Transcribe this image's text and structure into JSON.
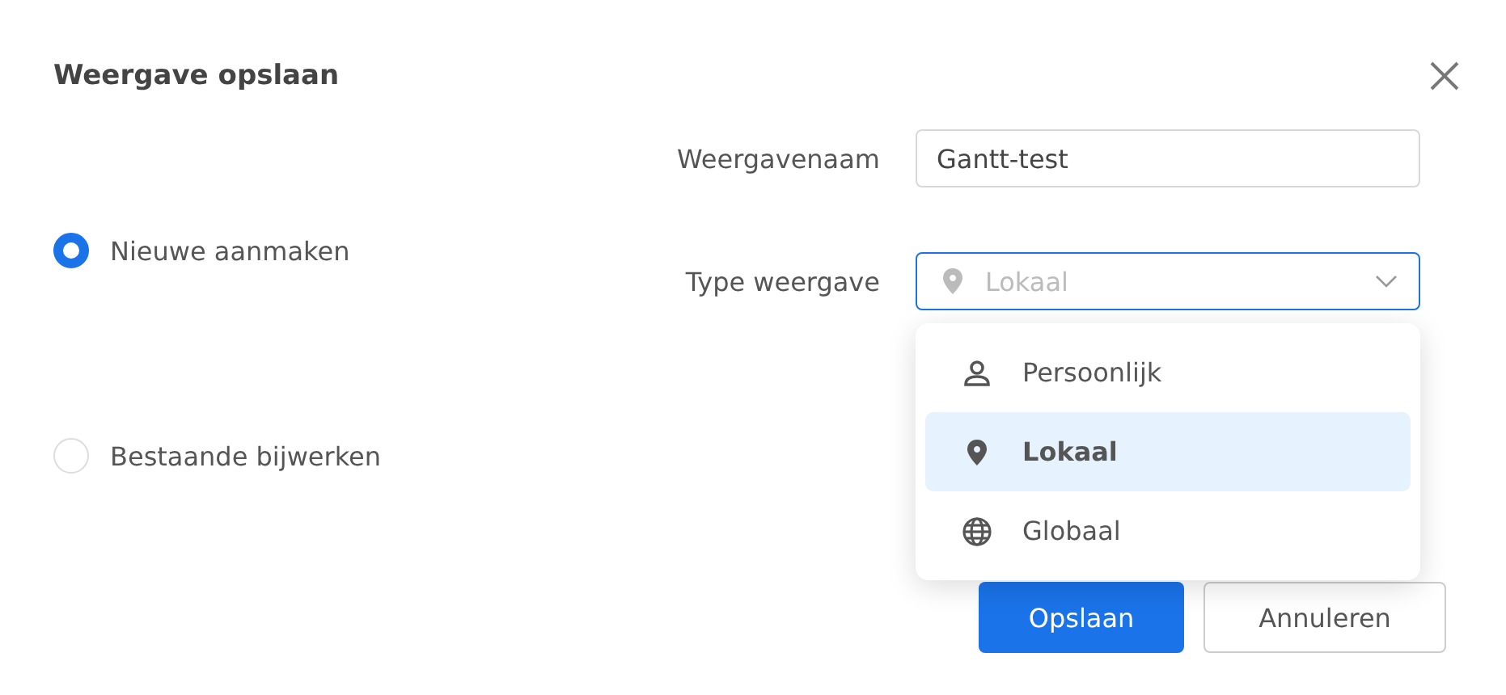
{
  "dialog": {
    "title": "Weergave opslaan"
  },
  "options": [
    {
      "label": "Nieuwe aanmaken",
      "selected": true
    },
    {
      "label": "Bestaande bijwerken",
      "selected": false
    }
  ],
  "fields": [
    {
      "kind": "text",
      "label": "Weergavenaam",
      "value": "Gantt-test"
    },
    {
      "kind": "select",
      "label": "Type weergave",
      "value": "Lokaal",
      "expanded": true
    }
  ],
  "dropdown": [
    {
      "label": "Persoonlijk",
      "kind": "person",
      "selected": false
    },
    {
      "label": "Lokaal",
      "kind": "pin",
      "selected": true
    },
    {
      "label": "Globaal",
      "kind": "globe",
      "selected": false
    }
  ],
  "buttons": [
    {
      "label": "Opslaan",
      "kind": "primary"
    },
    {
      "label": "Annuleren",
      "kind": "default"
    }
  ]
}
